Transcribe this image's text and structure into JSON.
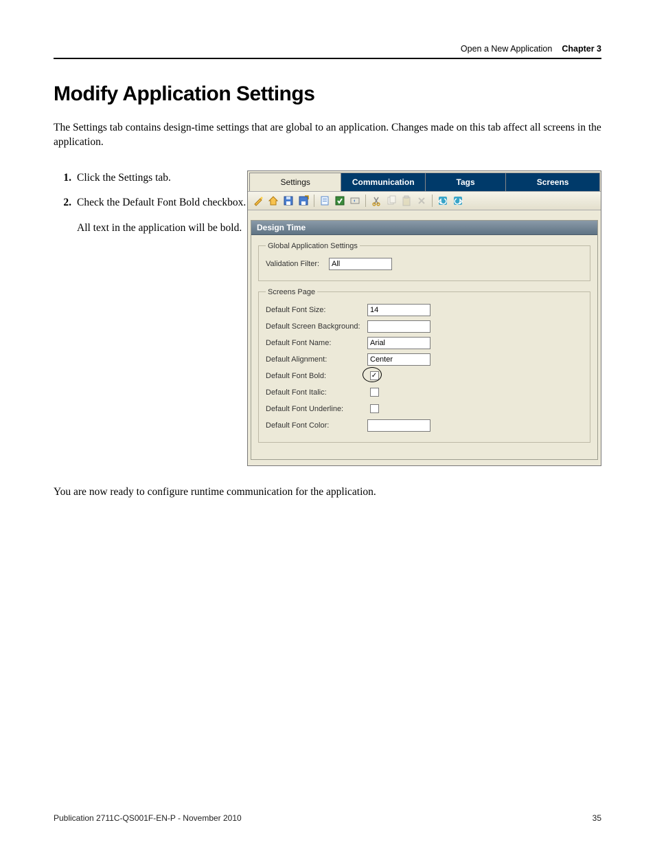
{
  "header": {
    "breadcrumb": "Open a New Application",
    "chapter": "Chapter 3"
  },
  "title": "Modify Application Settings",
  "intro": "The Settings tab contains design-time settings that are global to an application. Changes made on this tab affect all screens in the application.",
  "steps": {
    "s1_num": "1.",
    "s1_text": "Click the Settings tab.",
    "s2_num": "2.",
    "s2_text": "Check the Default Font Bold checkbox.",
    "s2_sub": "All text in the application will be bold."
  },
  "tabs": {
    "settings": "Settings",
    "communication": "Communication",
    "tags": "Tags",
    "screens": "Screens"
  },
  "panel": {
    "title": "Design Time",
    "grp1": {
      "legend": "Global Application Settings",
      "validation_filter_lbl": "Validation Filter:",
      "validation_filter_val": "All"
    },
    "grp2": {
      "legend": "Screens Page",
      "font_size_lbl": "Default Font Size:",
      "font_size_val": "14",
      "screen_bg_lbl": "Default Screen Background:",
      "font_name_lbl": "Default Font Name:",
      "font_name_val": "Arial",
      "alignment_lbl": "Default Alignment:",
      "alignment_val": "Center",
      "font_bold_lbl": "Default Font Bold:",
      "font_italic_lbl": "Default Font Italic:",
      "font_underline_lbl": "Default Font Underline:",
      "font_color_lbl": "Default Font Color:"
    }
  },
  "outro": "You are now ready to configure runtime communication for the application.",
  "footer": {
    "pub": "Publication 2711C-QS001F-EN-P - November 2010",
    "page": "35"
  }
}
